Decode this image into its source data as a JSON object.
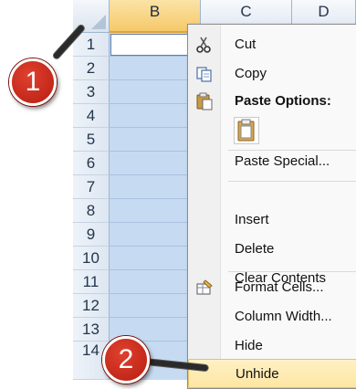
{
  "sheet": {
    "columns": [
      "B",
      "C",
      "D"
    ],
    "selected_column": "B",
    "rows": [
      "1",
      "2",
      "3",
      "4",
      "5",
      "6",
      "7",
      "8",
      "9",
      "10",
      "11",
      "12",
      "13",
      "14"
    ]
  },
  "context_menu": {
    "items": [
      {
        "label": "Cut",
        "icon": "scissors-icon",
        "bold": false
      },
      {
        "label": "Copy",
        "icon": "copy-icon",
        "bold": false
      },
      {
        "label": "Paste Options:",
        "icon": "paste-icon",
        "bold": true
      },
      {
        "label": "Paste Special...",
        "icon": "",
        "bold": false
      },
      {
        "label": "Insert",
        "icon": "",
        "bold": false
      },
      {
        "label": "Delete",
        "icon": "",
        "bold": false
      },
      {
        "label": "Clear Contents",
        "icon": "",
        "bold": false
      },
      {
        "label": "Format Cells...",
        "icon": "format-cells-icon",
        "bold": false
      },
      {
        "label": "Column Width...",
        "icon": "",
        "bold": false
      },
      {
        "label": "Hide",
        "icon": "",
        "bold": false
      },
      {
        "label": "Unhide",
        "icon": "",
        "bold": false,
        "highlighted": true
      }
    ]
  },
  "callouts": {
    "first": "1",
    "second": "2"
  },
  "colors": {
    "selected_column_fill": "#c6dbf2",
    "selected_header": "#f6c96a",
    "menu_highlight": "#fde6a3",
    "callout_red": "#c92a1a"
  }
}
